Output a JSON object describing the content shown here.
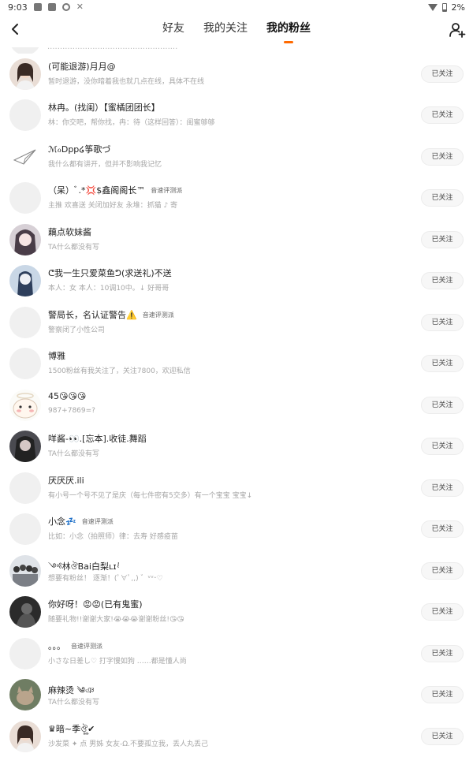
{
  "status_bar": {
    "time": "9:03",
    "battery": "2%"
  },
  "header": {
    "tabs": [
      {
        "label": "好友"
      },
      {
        "label": "我的关注"
      },
      {
        "label": "我的粉丝"
      }
    ],
    "active_tab": "我的粉丝",
    "accent_color": "#ff6a00"
  },
  "follow_button_label": "已关注",
  "followers": [
    {
      "name": "(可能退游)月月@",
      "bio": "暂时退游，没你暗着我也就几点在线，具体不在线"
    },
    {
      "name": "林冉。(找闺）【蜜橘团团长】",
      "bio": "林：你交吧，帮你找，冉：待（这样回答）：闺蜜够够"
    },
    {
      "name": "ℳℴDpp໒筝歌づ",
      "bio": "我什么都有讲开，但并不影响我记忆"
    },
    {
      "name": "（呆）ﾞ.*💢$鑫阁阁长™",
      "badge": "音速评测派",
      "bio": "主推 欢喜送 关闭加好友 永堆：抓猫 ♪ 寄"
    },
    {
      "name": "藕点软妹酱",
      "bio": "TA什么都没有写"
    },
    {
      "name": "ᕦ我一生只爱菜鱼ᕤ(求送礼)不送",
      "bio": "本人：女 本人：10调10中。↓ 好哥哥"
    },
    {
      "name": "警局长，名认证警告⚠️",
      "badge": "音速评测派",
      "bio": "警察闭了小性公司"
    },
    {
      "name": "博雅",
      "bio": "1500粉丝有我关注了，关注7800，欢迎私信"
    },
    {
      "name": "45😘😘😘",
      "bio": "987+7869=?"
    },
    {
      "name": "咩酱-👀.[忘本].收徒.舞蹈",
      "bio": "TA什么都没有写"
    },
    {
      "name": "厌厌厌.ili",
      "bio": "有小号一个号不见了是庆（每七件密有5交多）有一个宝宝 宝宝↓"
    },
    {
      "name": "小念💤",
      "badge": "音速评测派",
      "bio": "比如：小念（拍照师）律：去寿 好感疫苗"
    },
    {
      "name": "༺林ঔBai白梨ʟɪ ̊ͣ",
      "bio": "想要有粉丝！ 逐渐！(ﾟ∀ﾟ,,) ゛ᵛᵛᵕ♡"
    },
    {
      "name": "你好呀！😡😡(已有鬼蜜)",
      "bio": "随要礼物!!谢谢大家!😭😭😭谢谢粉丝!😘😘"
    },
    {
      "name": "。。。",
      "badge": "音速评测派",
      "bio": "小さな日差し♡ 打字慢如狗 ……都是懂人尚"
    },
    {
      "name": "麻辣烫 ༄ঞ",
      "bio": "TA什么都没有写"
    },
    {
      "name": "♛暗~季ঔৣ✔",
      "bio": "沙发菜 ✦ 点 男姊 女友-Ω.不要孤立我，丢人丸丢己"
    }
  ],
  "partial_row_text": "....................................................",
  "avatars": [
    "girl-photo-avatar",
    "blank-avatar",
    "paper-plane-avatar",
    "blank-avatar",
    "anime-girl-avatar",
    "anime-girl-blue-avatar",
    "blank-avatar",
    "blank-avatar",
    "cartoon-bear-avatar",
    "dark-girl-avatar",
    "blank-avatar",
    "blank-avatar",
    "group-photo-avatar",
    "dark-photo-avatar",
    "blank-avatar",
    "cat-photo-avatar",
    "girl-photo-avatar"
  ]
}
